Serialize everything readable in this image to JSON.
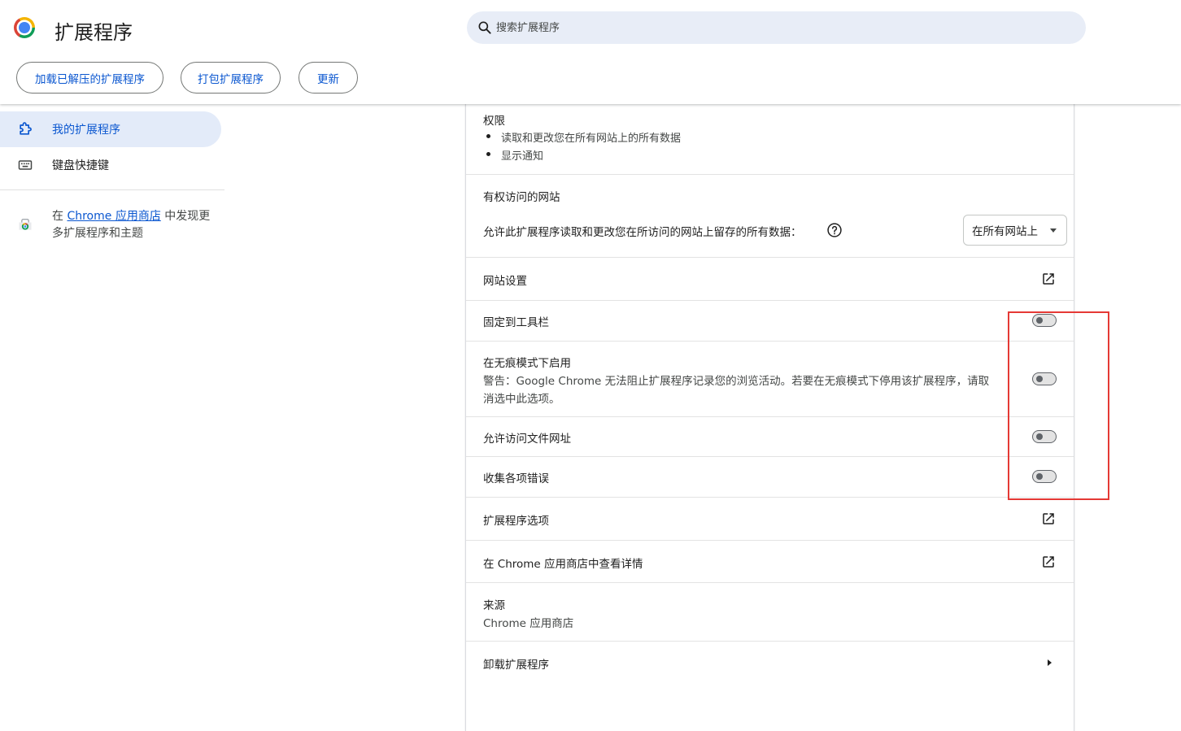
{
  "app": {
    "title": "扩展程序"
  },
  "search": {
    "placeholder": "搜索扩展程序"
  },
  "toolbar": {
    "load_unpacked": "加载已解压的扩展程序",
    "pack": "打包扩展程序",
    "update": "更新"
  },
  "sidebar": {
    "items": [
      {
        "label": "我的扩展程序",
        "icon": "puzzle-icon"
      },
      {
        "label": "键盘快捷键",
        "icon": "keyboard-icon"
      }
    ],
    "promo": {
      "prefix": "在 ",
      "link": "Chrome 应用商店",
      "suffix": " 中发现更多扩展程序和主题"
    }
  },
  "details": {
    "permissions": {
      "title": "权限",
      "items": [
        "读取和更改您在所有网站上的所有数据",
        "显示通知"
      ]
    },
    "site_access": {
      "title": "有权访问的网站",
      "description": "允许此扩展程序读取和更改您在所访问的网站上留存的所有数据：",
      "selected": "在所有网站上"
    },
    "site_settings": "网站设置",
    "pin_toolbar": {
      "label": "固定到工具栏",
      "enabled": false
    },
    "incognito": {
      "label": "在无痕模式下启用",
      "warning_line1": "警告：Google Chrome 无法阻止扩展程序记录您的浏览活动。若要在无痕模式下停用该扩展程序，请取",
      "warning_line2": "消选中此选项。",
      "enabled": false
    },
    "file_urls": {
      "label": "允许访问文件网址",
      "enabled": false
    },
    "collect_errors": {
      "label": "收集各项错误",
      "enabled": false
    },
    "extension_options": "扩展程序选项",
    "view_in_store": "在 Chrome 应用商店中查看详情",
    "source": {
      "title": "来源",
      "value": "Chrome 应用商店"
    },
    "uninstall": "卸载扩展程序"
  },
  "colors": {
    "accent": "#0b57d0",
    "highlight": "#e53935",
    "active_bg": "#e3ebf9"
  }
}
